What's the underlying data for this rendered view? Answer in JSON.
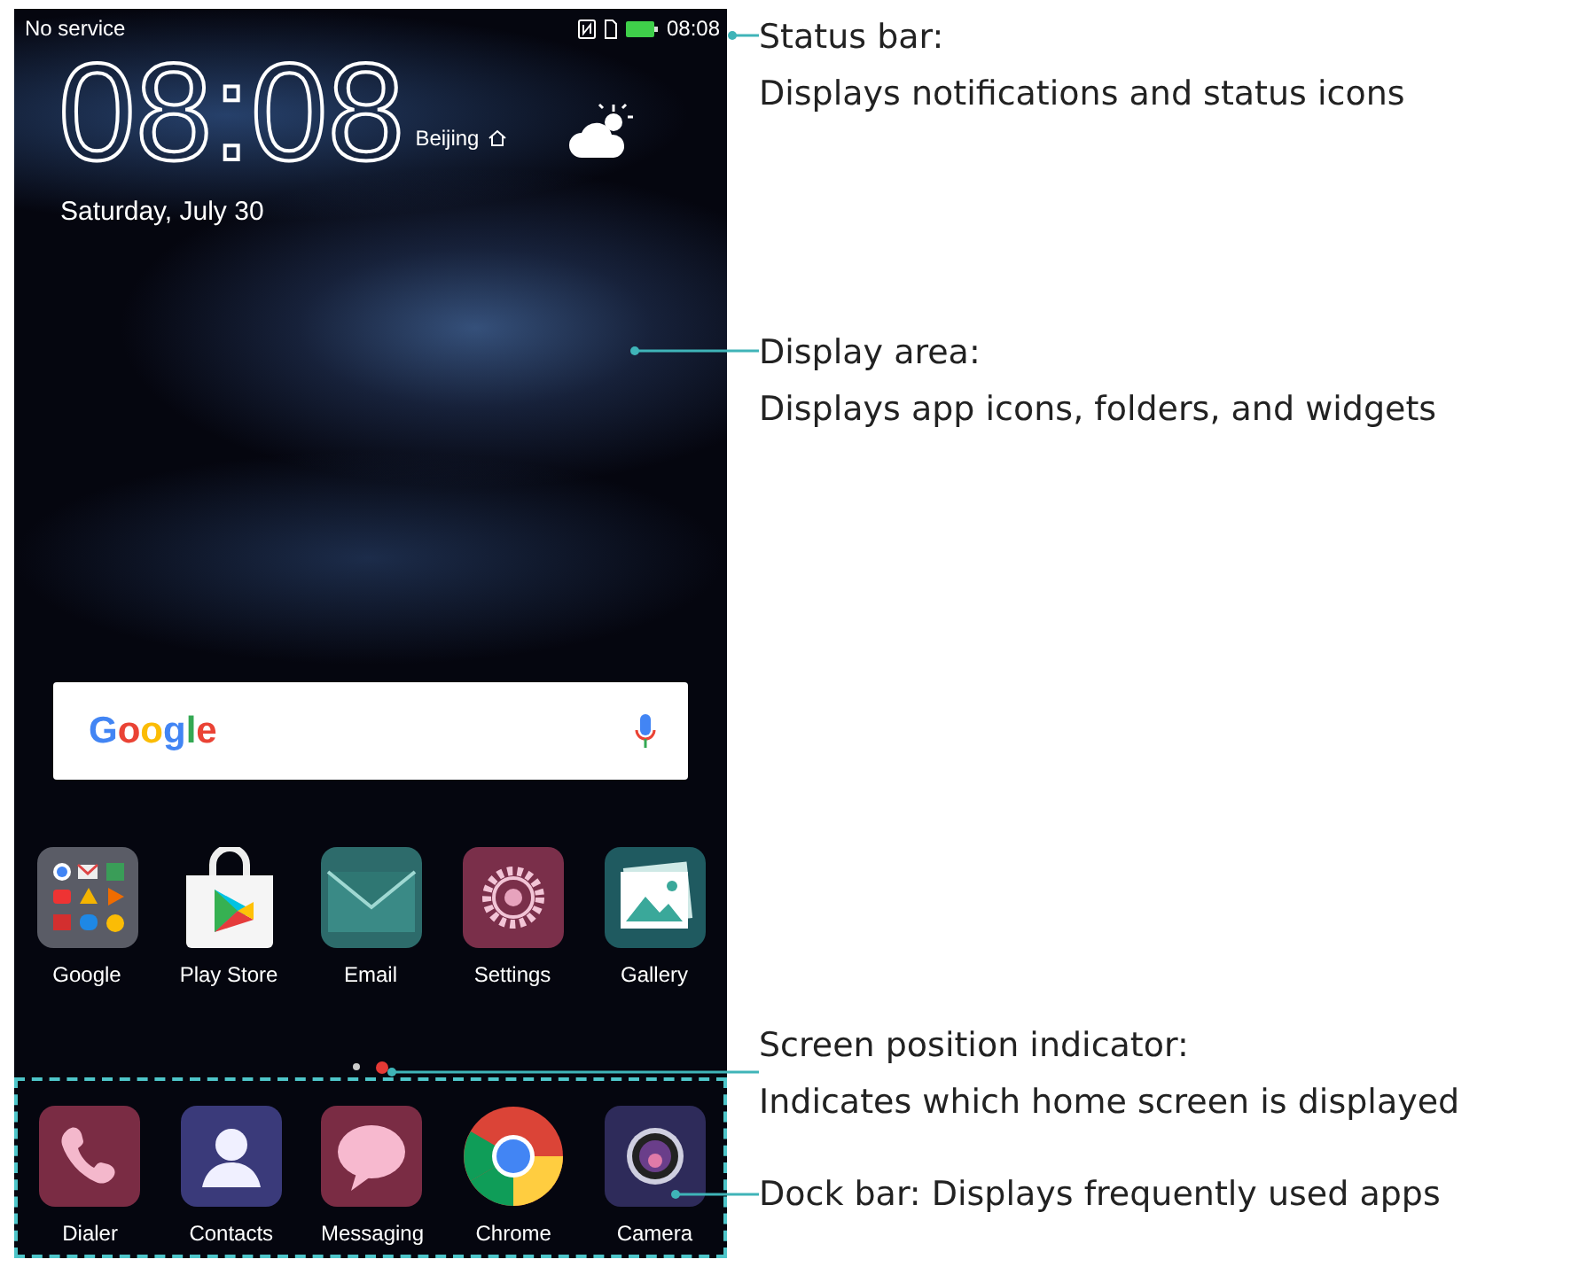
{
  "status_bar": {
    "carrier": "No service",
    "time": "08:08"
  },
  "clock_widget": {
    "time": "08:08",
    "city": "Beijing",
    "date": "Saturday, July 30"
  },
  "search_bar": {
    "logo": "Google"
  },
  "apps": [
    {
      "label": "Google",
      "kind": "folder"
    },
    {
      "label": "Play Store",
      "kind": "playstore"
    },
    {
      "label": "Email",
      "kind": "email"
    },
    {
      "label": "Settings",
      "kind": "settings"
    },
    {
      "label": "Gallery",
      "kind": "gallery"
    }
  ],
  "page_indicator": [
    {
      "selected": false
    },
    {
      "selected": true
    }
  ],
  "dock": [
    {
      "label": "Dialer",
      "kind": "dialer"
    },
    {
      "label": "Contacts",
      "kind": "contacts"
    },
    {
      "label": "Messaging",
      "kind": "messaging"
    },
    {
      "label": "Chrome",
      "kind": "chrome"
    },
    {
      "label": "Camera",
      "kind": "camera"
    }
  ],
  "callouts": [
    {
      "kind": "status_bar",
      "lines": [
        "Status bar:",
        "Displays notifications and status icons"
      ]
    },
    {
      "kind": "display_area",
      "lines": [
        "Display area:",
        "Displays app icons, folders, and widgets"
      ]
    },
    {
      "kind": "page_indicator",
      "lines": [
        "Screen position indicator:",
        "Indicates which home screen is displayed"
      ]
    },
    {
      "kind": "dock",
      "lines": [
        "Dock bar: Displays frequently used apps"
      ]
    }
  ]
}
